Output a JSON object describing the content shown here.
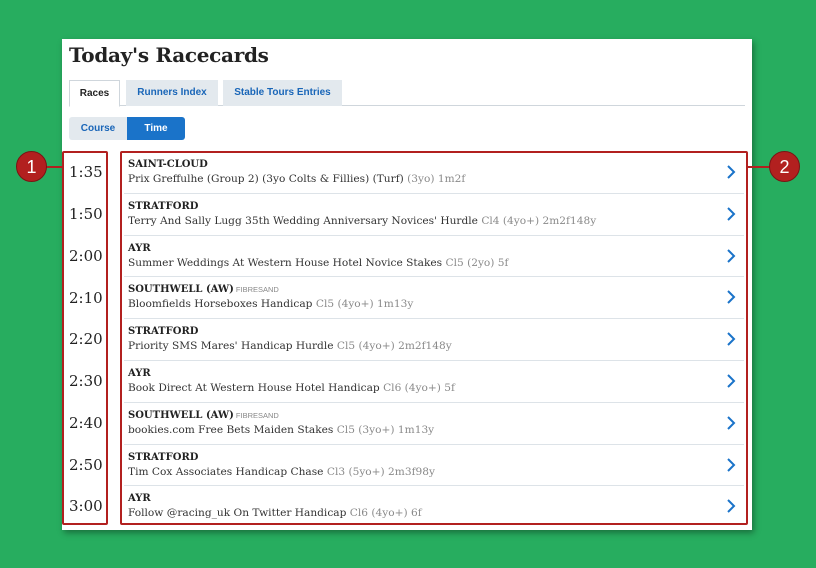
{
  "page": {
    "title": "Today's Racecards"
  },
  "tabs": [
    {
      "label": "Races",
      "active": true
    },
    {
      "label": "Runners Index",
      "active": false
    },
    {
      "label": "Stable Tours Entries",
      "active": false
    }
  ],
  "sort": {
    "course_label": "Course",
    "time_label": "Time",
    "selected": "Time"
  },
  "races": [
    {
      "time": "1:35",
      "course": "SAINT-CLOUD",
      "surface": "",
      "name": "Prix Greffulhe (Group 2) (3yo Colts & Fillies) (Turf)",
      "meta": "(3yo) 1m2f"
    },
    {
      "time": "1:50",
      "course": "STRATFORD",
      "surface": "",
      "name": "Terry And Sally Lugg 35th Wedding Anniversary Novices' Hurdle",
      "meta": "Cl4 (4yo+) 2m2f148y"
    },
    {
      "time": "2:00",
      "course": "AYR",
      "surface": "",
      "name": "Summer Weddings At Western House Hotel Novice Stakes",
      "meta": "Cl5 (2yo) 5f"
    },
    {
      "time": "2:10",
      "course": "SOUTHWELL (AW)",
      "surface": "FIBRESAND",
      "name": "Bloomfields Horseboxes Handicap",
      "meta": "Cl5 (4yo+) 1m13y"
    },
    {
      "time": "2:20",
      "course": "STRATFORD",
      "surface": "",
      "name": "Priority SMS Mares' Handicap Hurdle",
      "meta": "Cl5 (4yo+) 2m2f148y"
    },
    {
      "time": "2:30",
      "course": "AYR",
      "surface": "",
      "name": "Book Direct At Western House Hotel Handicap",
      "meta": "Cl6 (4yo+) 5f"
    },
    {
      "time": "2:40",
      "course": "SOUTHWELL (AW)",
      "surface": "FIBRESAND",
      "name": "bookies.com Free Bets Maiden Stakes",
      "meta": "Cl5 (3yo+) 1m13y"
    },
    {
      "time": "2:50",
      "course": "STRATFORD",
      "surface": "",
      "name": "Tim Cox Associates Handicap Chase",
      "meta": "Cl3 (5yo+) 2m3f98y"
    },
    {
      "time": "3:00",
      "course": "AYR",
      "surface": "",
      "name": "Follow @racing_uk On Twitter Handicap",
      "meta": "Cl6 (4yo+) 6f"
    }
  ],
  "annotations": {
    "marker1": "1",
    "marker2": "2",
    "color": "#b2201f"
  },
  "colors": {
    "background": "#27ad5f",
    "accent": "#1a73c9",
    "link": "#1a66b8"
  },
  "icons": {
    "row_arrow": "chevron-right-icon"
  }
}
